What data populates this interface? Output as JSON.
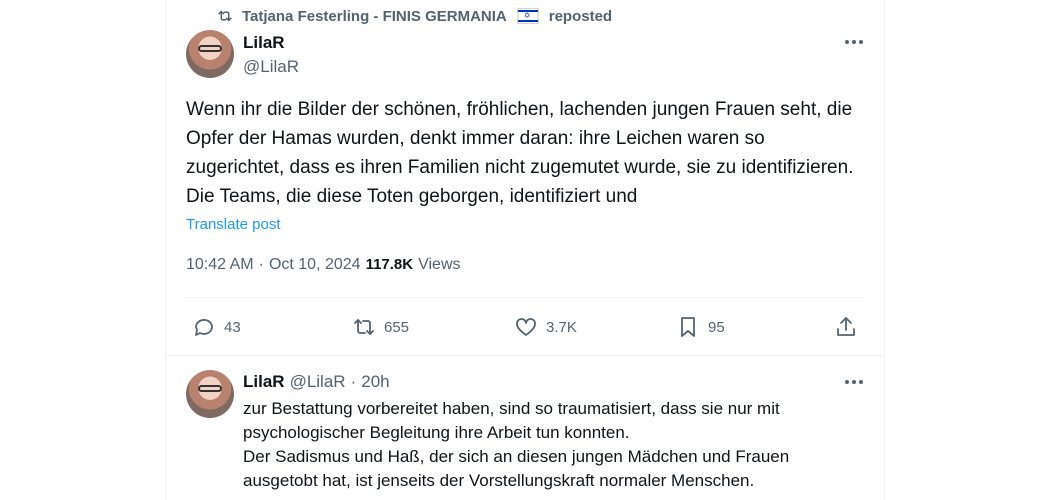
{
  "repost": {
    "text": "Tatjana Festerling - FINIS GERMANIA",
    "flag_icon": "israel-flag-icon",
    "suffix": "reposted"
  },
  "post": {
    "name": "LilaR",
    "handle": "@LilaR",
    "text": "Wenn ihr die Bilder der schönen, fröhlichen, lachenden jungen Frauen seht, die Opfer der Hamas wurden, denkt immer daran: ihre Leichen waren so zugerichtet, dass es ihren Familien nicht zugemutet wurde, sie zu identifizieren. Die Teams, die diese Toten geborgen, identifiziert und",
    "translate": "Translate post",
    "time": "10:42 AM",
    "dot": "·",
    "date": "Oct 10, 2024",
    "views_count": "117.8K",
    "views_label": "Views",
    "actions": {
      "replies": "43",
      "reposts": "655",
      "likes": "3.7K",
      "bookmarks": "95"
    }
  },
  "reply": {
    "name": "LilaR",
    "handle": "@LilaR",
    "dot": "·",
    "time": "20h",
    "text": "zur Bestattung vorbereitet haben, sind so traumatisiert, dass sie nur mit psychologischer Begleitung ihre Arbeit tun konnten.\nDer Sadismus und Haß, der sich an diesen jungen Mädchen und Frauen ausgetobt hat, ist jenseits der Vorstellungskraft normaler Menschen."
  },
  "colors": {
    "accent": "#1d9bf0",
    "secondary_text": "#536471",
    "primary_text": "#0f1419",
    "border": "#eff3f4"
  }
}
